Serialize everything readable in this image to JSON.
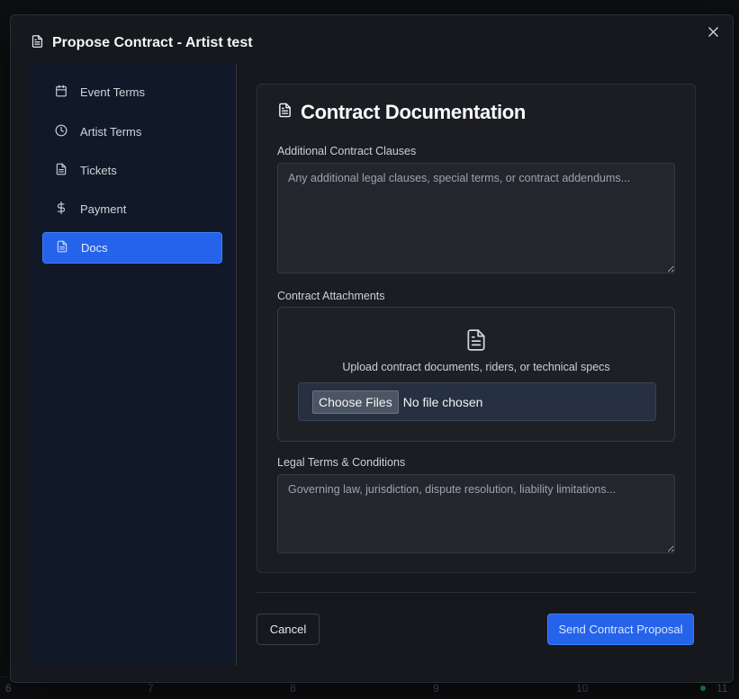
{
  "modal": {
    "title": "Propose Contract - Artist test",
    "close_icon": "close-icon",
    "header_icon": "document-icon"
  },
  "sidebar": {
    "items": [
      {
        "label": "Event Terms",
        "icon": "calendar-icon",
        "active": false
      },
      {
        "label": "Artist Terms",
        "icon": "clock-icon",
        "active": false
      },
      {
        "label": "Tickets",
        "icon": "document-icon",
        "active": false
      },
      {
        "label": "Payment",
        "icon": "dollar-icon",
        "active": false
      },
      {
        "label": "Docs",
        "icon": "document-icon",
        "active": true
      }
    ]
  },
  "section": {
    "title": "Contract Documentation",
    "icon": "document-icon",
    "clauses": {
      "label": "Additional Contract Clauses",
      "placeholder": "Any additional legal clauses, special terms, or contract addendums...",
      "value": ""
    },
    "attachments": {
      "label": "Contract Attachments",
      "upload_text": "Upload contract documents, riders, or technical specs",
      "choose_label": "Choose Files",
      "file_status": "No file chosen"
    },
    "legal": {
      "label": "Legal Terms & Conditions",
      "placeholder": "Governing law, jurisdiction, dispute resolution, liability limitations...",
      "value": ""
    }
  },
  "footer": {
    "cancel_label": "Cancel",
    "send_label": "Send Contract Proposal"
  },
  "background": {
    "calendar_numbers": [
      "6",
      "7",
      "8",
      "9",
      "10",
      "11"
    ]
  },
  "colors": {
    "accent": "#2563eb",
    "modal_bg": "#16181d",
    "sidebar_bg": "#111827",
    "status_green": "#16a34a"
  }
}
